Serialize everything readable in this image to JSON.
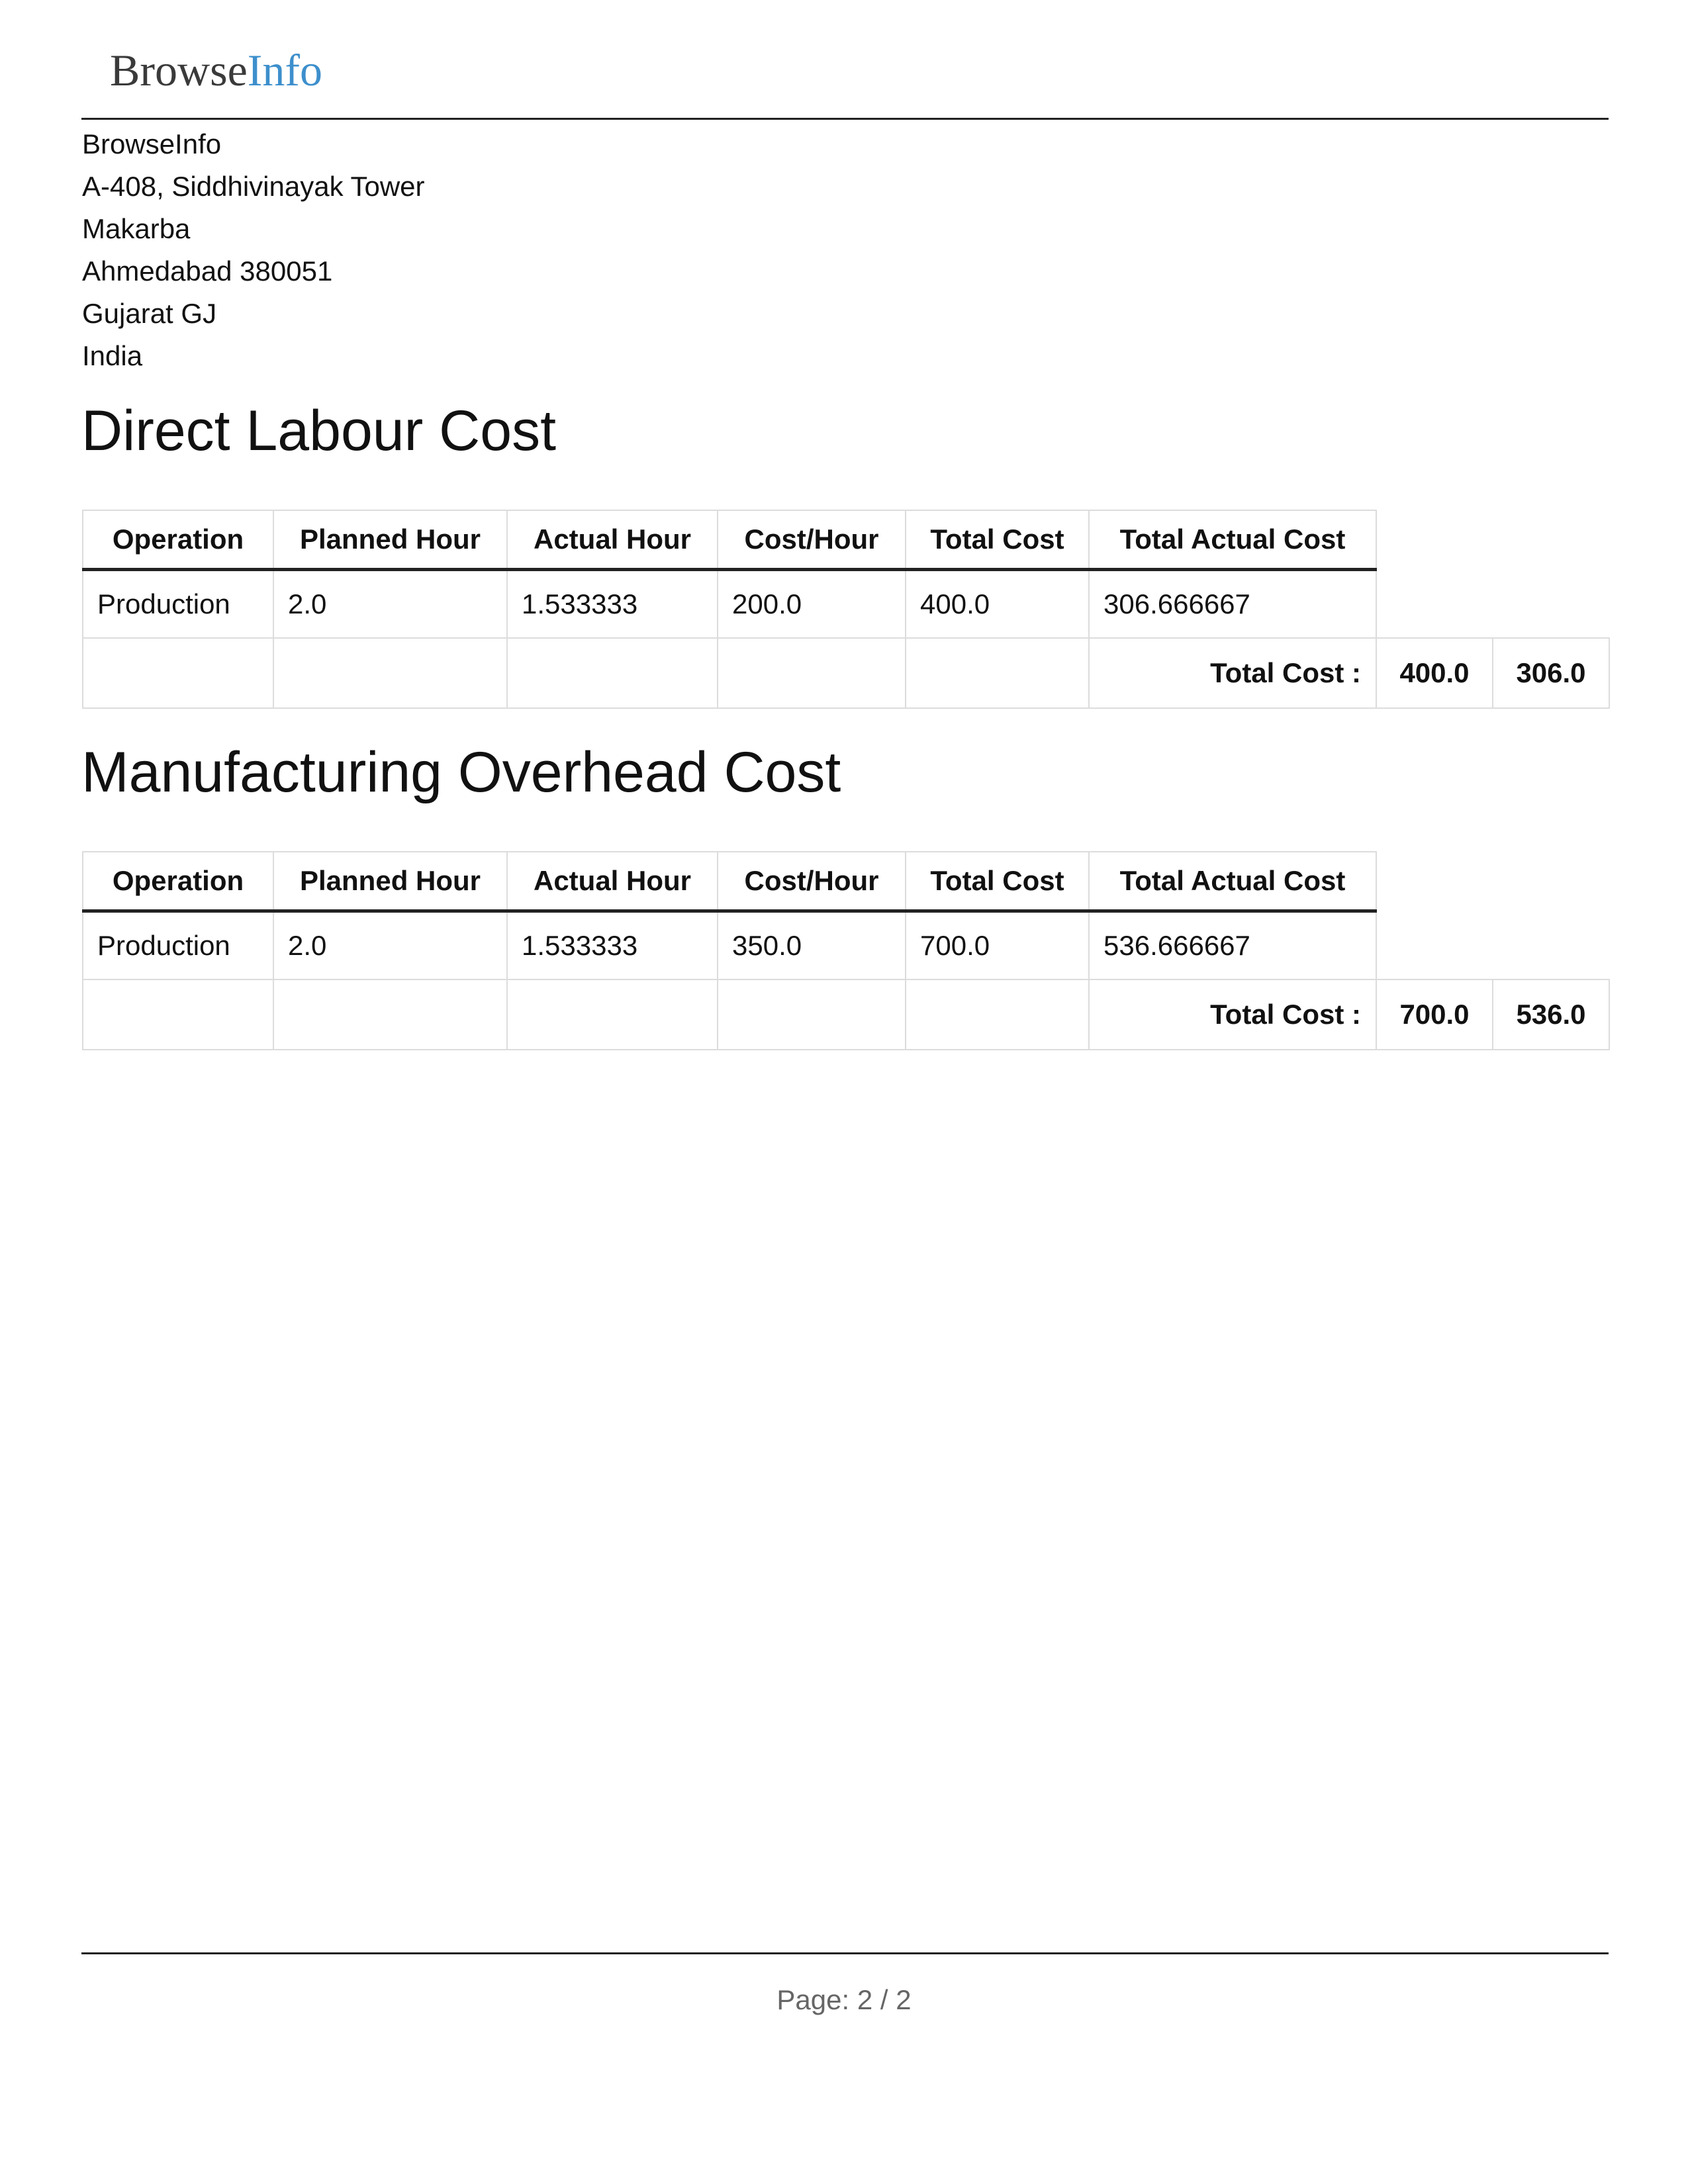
{
  "header": {
    "logo_part1": "Browse",
    "logo_part2": "Info"
  },
  "company": {
    "name": "BrowseInfo",
    "street": "A-408, Siddhivinayak Tower",
    "area": "Makarba",
    "city_zip": "Ahmedabad 380051",
    "state": "Gujarat GJ",
    "country": "India"
  },
  "labour": {
    "title": "Direct Labour Cost",
    "columns": [
      "Operation",
      "Planned Hour",
      "Actual Hour",
      "Cost/Hour",
      "Total Cost",
      "Total Actual Cost"
    ],
    "rows": [
      {
        "operation": "Production",
        "planned_hour": "2.0",
        "actual_hour": "1.533333",
        "cost_per_hour": "200.0",
        "total_cost": "400.0",
        "total_actual_cost": "306.666667"
      }
    ],
    "total_label": "Total Cost :",
    "total_cost": "400.0",
    "total_actual_cost": "306.0"
  },
  "overhead": {
    "title": "Manufacturing Overhead Cost",
    "columns": [
      "Operation",
      "Planned Hour",
      "Actual Hour",
      "Cost/Hour",
      "Total Cost",
      "Total Actual Cost"
    ],
    "rows": [
      {
        "operation": "Production",
        "planned_hour": "2.0",
        "actual_hour": "1.533333",
        "cost_per_hour": "350.0",
        "total_cost": "700.0",
        "total_actual_cost": "536.666667"
      }
    ],
    "total_label": "Total Cost :",
    "total_cost": "700.0",
    "total_actual_cost": "536.0"
  },
  "footer": {
    "page_label": "Page: 2 / 2"
  }
}
